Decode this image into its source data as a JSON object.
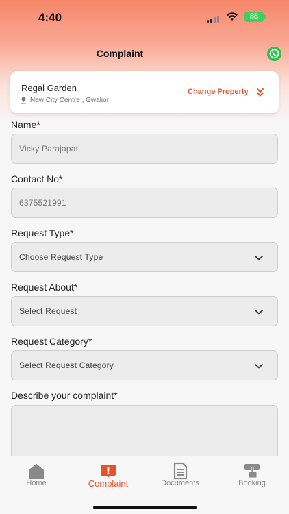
{
  "status_bar": {
    "time": "4:40",
    "battery": "88"
  },
  "header": {
    "title": "Complaint"
  },
  "property": {
    "name": "Regal Garden",
    "location": "New City Centre , Gwalior",
    "change_label": "Change Property"
  },
  "form": {
    "name": {
      "label": "Name*",
      "value": "Vicky Parajapati"
    },
    "contact": {
      "label": "Contact No*",
      "value": "6375521991"
    },
    "request_type": {
      "label": "Request Type*",
      "value": "Choose Request Type"
    },
    "request_about": {
      "label": "Request About*",
      "value": "Select Request"
    },
    "request_category": {
      "label": "Request Category*",
      "value": "Select Request Category"
    },
    "description": {
      "label": "Describe your complaint*"
    }
  },
  "tabs": [
    {
      "label": "Home",
      "icon": "home-icon"
    },
    {
      "label": "Complaint",
      "icon": "complaint-icon",
      "active": true
    },
    {
      "label": "Documents",
      "icon": "documents-icon"
    },
    {
      "label": "Booking",
      "icon": "booking-icon"
    }
  ],
  "colors": {
    "accent": "#e6522c",
    "header_gradient_top": "#f6866a",
    "whatsapp": "#2fc04f",
    "battery": "#3ecf5c"
  }
}
